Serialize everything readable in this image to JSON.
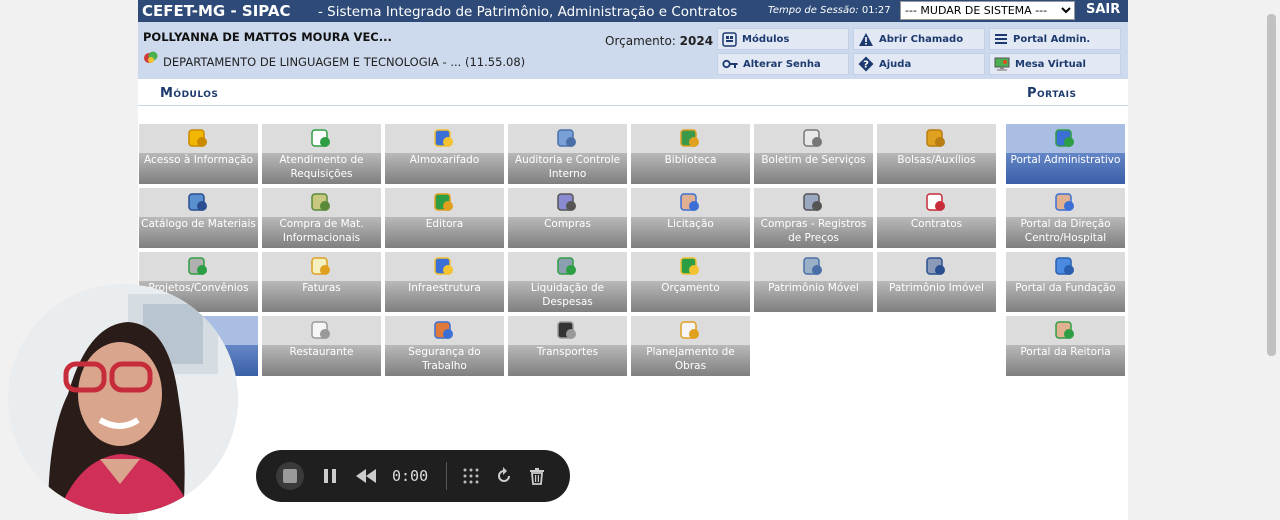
{
  "header": {
    "title": "CEFET-MG - SIPAC",
    "subtitle": "- Sistema Integrado de Patrimônio, Administração e Contratos",
    "session_label": "Tempo de Sessão:",
    "session_time": "01:27",
    "system_select": "--- MUDAR DE SISTEMA ---",
    "exit_label": "SAIR"
  },
  "info": {
    "user": "POLLYANNA DE MATTOS MOURA VEC...",
    "department": "DEPARTAMENTO DE LINGUAGEM E TECNOLOGIA - ... (11.55.08)",
    "budget_label": "Orçamento:",
    "budget_year": "2024"
  },
  "quick_links": {
    "modules": "Módulos",
    "open_ticket": "Abrir Chamado",
    "admin_portal": "Portal Admin.",
    "change_password": "Alterar Senha",
    "help": "Ajuda",
    "virtual_desk": "Mesa Virtual"
  },
  "sections": {
    "modules_title": "Módulos",
    "portals_title": "Portais"
  },
  "modules": [
    {
      "label": "Acesso à Informação",
      "icon": "info-icon"
    },
    {
      "label": "Atendimento de Requisições",
      "icon": "document-check-icon"
    },
    {
      "label": "Almoxarifado",
      "icon": "boxes-icon"
    },
    {
      "label": "Auditoria e Controle Interno",
      "icon": "auditor-icon"
    },
    {
      "label": "Biblioteca",
      "icon": "books-icon"
    },
    {
      "label": "Boletim de Serviços",
      "icon": "bulletin-icon"
    },
    {
      "label": "Bolsas/Auxílios",
      "icon": "folder-icon"
    },
    {
      "label": "Catálogo de Materiais",
      "icon": "catalog-icon"
    },
    {
      "label": "Compra de Mat. Informacionais",
      "icon": "purchase-icon"
    },
    {
      "label": "Editora",
      "icon": "books-stack-icon"
    },
    {
      "label": "Compras",
      "icon": "cart-icon"
    },
    {
      "label": "Licitação",
      "icon": "people-icon"
    },
    {
      "label": "Compras - Registros de Preços",
      "icon": "price-register-icon"
    },
    {
      "label": "Contratos",
      "icon": "contract-icon"
    },
    {
      "label": "Projetos/Convênios",
      "icon": "projects-icon"
    },
    {
      "label": "Faturas",
      "icon": "invoice-icon"
    },
    {
      "label": "Infraestrutura",
      "icon": "worker-icon"
    },
    {
      "label": "Liquidação de Despesas",
      "icon": "cart-money-icon"
    },
    {
      "label": "Orçamento",
      "icon": "budget-icon"
    },
    {
      "label": "Patrimônio Móvel",
      "icon": "furniture-icon"
    },
    {
      "label": "Patrimônio Imóvel",
      "icon": "building-icon"
    },
    {
      "label": "",
      "icon": "blank-icon"
    },
    {
      "label": "Restaurante",
      "icon": "cup-icon"
    },
    {
      "label": "Segurança do Trabalho",
      "icon": "safety-worker-icon"
    },
    {
      "label": "Transportes",
      "icon": "wheel-icon"
    },
    {
      "label": "Planejamento de Obras",
      "icon": "planning-icon"
    }
  ],
  "portals": [
    {
      "label": "Portal Administrativo",
      "icon": "org-chart-icon",
      "active": true
    },
    {
      "label": "Portal da Direção Centro/Hospital",
      "icon": "people-icon"
    },
    {
      "label": "Portal da Fundação",
      "icon": "globe-icon"
    },
    {
      "label": "Portal da Reitoria",
      "icon": "person-icon"
    }
  ],
  "recorder": {
    "time": "0:00"
  },
  "colors": {
    "header_bg": "#2d4a78",
    "info_bg": "#cdd9ec",
    "tile_active": "#3a5fa8",
    "recorder_bg": "#1f1f1f"
  }
}
